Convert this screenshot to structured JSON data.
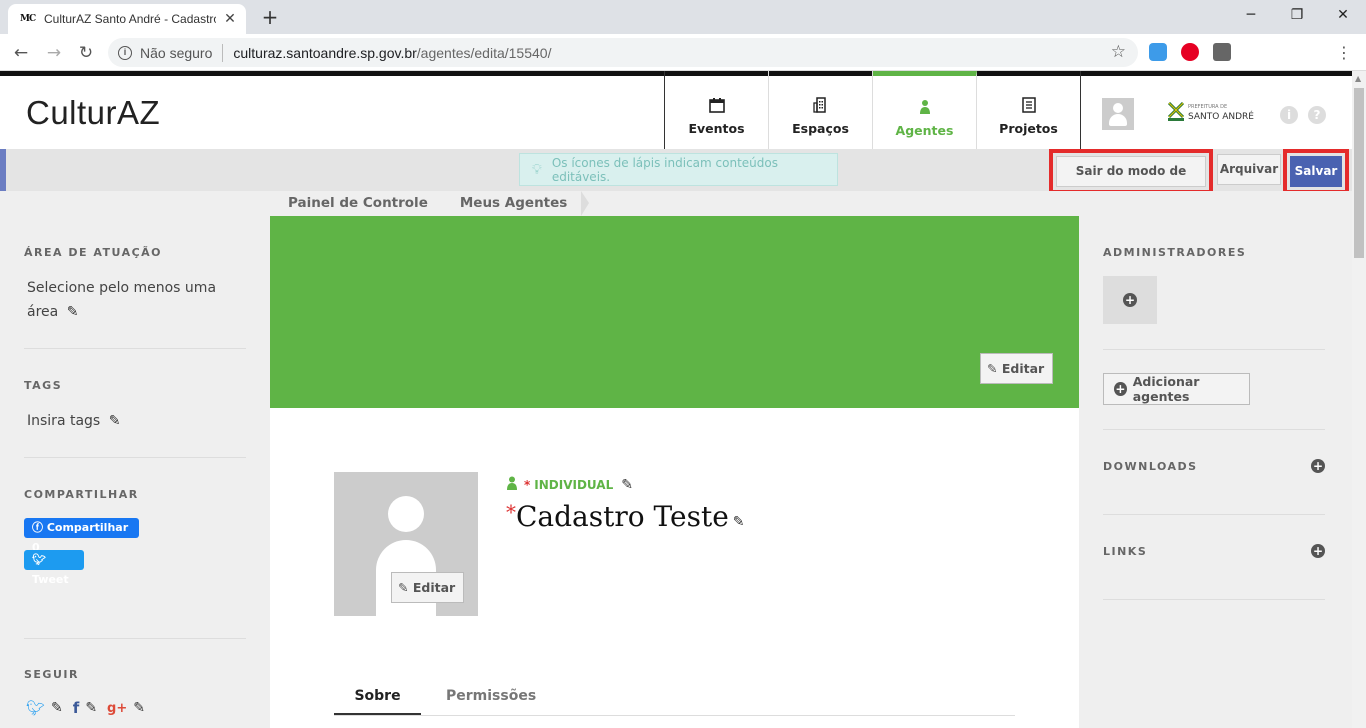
{
  "browser": {
    "tab_favicon": "MC",
    "tab_title": "CulturAZ Santo André - Cadastro",
    "security_label": "Não seguro",
    "url_host": "culturaz.santoandre.sp.gov.br",
    "url_path": "/agentes/edita/15540/"
  },
  "header": {
    "logo": "CulturAZ",
    "nav": [
      {
        "label": "Eventos",
        "icon": "calendar-icon"
      },
      {
        "label": "Espaços",
        "icon": "building-icon"
      },
      {
        "label": "Agentes",
        "icon": "person-icon"
      },
      {
        "label": "Projetos",
        "icon": "document-icon"
      }
    ],
    "active_nav": "Agentes",
    "prefeitura_small": "PREFEITURA DE",
    "prefeitura": "SANTO ANDRÉ"
  },
  "editbar": {
    "hint": "Os ícones de lápis indicam conteúdos editáveis.",
    "exit_label": "Sair do modo de edição",
    "archive_label": "Arquivar",
    "save_label": "Salvar"
  },
  "breadcrumb": [
    "Painel de Controle",
    "Meus Agentes"
  ],
  "left": {
    "area_title": "ÁREA DE ATUAÇÃO",
    "area_text_1": "Selecione pelo menos uma",
    "area_text_2": "área",
    "tags_title": "TAGS",
    "tags_text": "Insira tags",
    "share_title": "COMPARTILHAR",
    "fb_label": "Compartilhar 0",
    "tw_label": "Tweet",
    "follow_title": "SEGUIR"
  },
  "main": {
    "cover_edit": "Editar",
    "avatar_edit": "Editar",
    "type_label": "INDIVIDUAL",
    "agent_name": "Cadastro Teste",
    "tabs": [
      "Sobre",
      "Permissões"
    ]
  },
  "right": {
    "admins_title": "ADMINISTRADORES",
    "add_agents": "Adicionar agentes",
    "downloads_title": "DOWNLOADS",
    "links_title": "LINKS"
  },
  "colors": {
    "brand_green": "#5fb446",
    "save_blue": "#4a62b1",
    "highlight_red": "#e42b2b"
  }
}
